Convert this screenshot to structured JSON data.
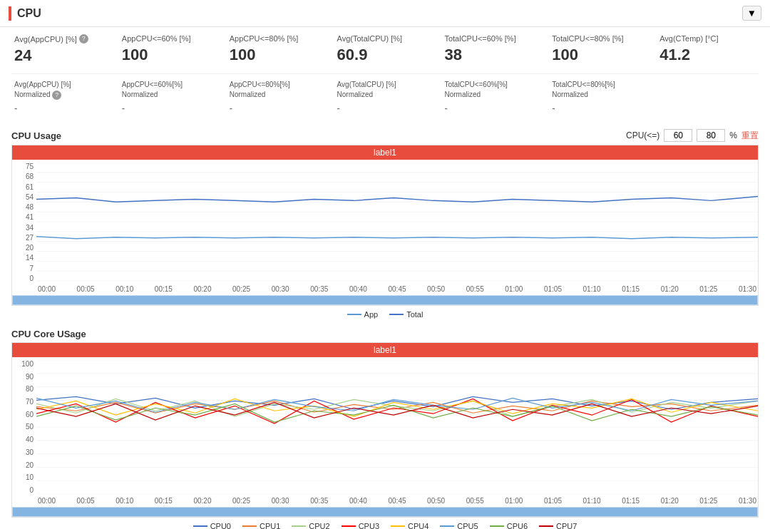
{
  "header": {
    "title": "CPU",
    "collapse_label": "▼"
  },
  "stats": {
    "row1": [
      {
        "label": "Avg(AppCPU) [%]",
        "has_help": true,
        "value": "24"
      },
      {
        "label": "AppCPU<=60% [%]",
        "has_help": false,
        "value": "100"
      },
      {
        "label": "AppCPU<=80% [%]",
        "has_help": false,
        "value": "100"
      },
      {
        "label": "Avg(TotalCPU) [%]",
        "has_help": false,
        "value": "60.9"
      },
      {
        "label": "TotalCPU<=60% [%]",
        "has_help": false,
        "value": "38"
      },
      {
        "label": "TotalCPU<=80% [%]",
        "has_help": false,
        "value": "100"
      },
      {
        "label": "Avg(CTemp) [°C]",
        "has_help": false,
        "value": "41.2"
      }
    ],
    "row2": [
      {
        "label": "Avg(AppCPU) [%]\nNormalized",
        "has_help": true,
        "value": "-"
      },
      {
        "label": "AppCPU<=60%[%]\nNormalized",
        "has_help": false,
        "value": "-"
      },
      {
        "label": "AppCPU<=80%[%]\nNormalized",
        "has_help": false,
        "value": "-"
      },
      {
        "label": "Avg(TotalCPU) [%]\nNormalized",
        "has_help": false,
        "value": "-"
      },
      {
        "label": "TotalCPU<=60%[%]\nNormalized",
        "has_help": false,
        "value": "-"
      },
      {
        "label": "TotalCPU<=80%[%]\nNormalized",
        "has_help": false,
        "value": "-"
      }
    ]
  },
  "cpu_usage_chart": {
    "title": "CPU Usage",
    "label_bar": "label1",
    "controls_label": "CPU(<=)",
    "value1": "60",
    "value2": "80",
    "unit": "%",
    "reset_label": "重置",
    "y_axis": [
      "75",
      "68",
      "61",
      "54",
      "48",
      "41",
      "34",
      "27",
      "20",
      "14",
      "7",
      "0"
    ],
    "x_axis": [
      "00:00",
      "00:05",
      "00:10",
      "00:15",
      "00:20",
      "00:25",
      "00:30",
      "00:35",
      "00:40",
      "00:45",
      "00:50",
      "00:55",
      "01:00",
      "01:05",
      "01:10",
      "01:15",
      "01:20",
      "01:25",
      "01:30"
    ],
    "legend": [
      {
        "label": "App",
        "color": "#5b9bd5"
      },
      {
        "label": "Total",
        "color": "#4472c4"
      }
    ]
  },
  "cpu_core_chart": {
    "title": "CPU Core USage",
    "label_bar": "label1",
    "y_axis": [
      "100",
      "90",
      "80",
      "70",
      "60",
      "50",
      "40",
      "30",
      "20",
      "10",
      "0"
    ],
    "x_axis": [
      "00:00",
      "00:05",
      "00:10",
      "00:15",
      "00:20",
      "00:25",
      "00:30",
      "00:35",
      "00:40",
      "00:45",
      "00:50",
      "00:55",
      "01:00",
      "01:05",
      "01:10",
      "01:15",
      "01:20",
      "01:25",
      "01:30"
    ],
    "legend": [
      {
        "label": "CPU0",
        "color": "#4472c4"
      },
      {
        "label": "CPU1",
        "color": "#ed7d31"
      },
      {
        "label": "CPU2",
        "color": "#a9d18e"
      },
      {
        "label": "CPU3",
        "color": "#ff0000"
      },
      {
        "label": "CPU4",
        "color": "#ffc000"
      },
      {
        "label": "CPU5",
        "color": "#5b9bd5"
      },
      {
        "label": "CPU6",
        "color": "#70ad47"
      },
      {
        "label": "CPU7",
        "color": "#c00000"
      }
    ]
  }
}
